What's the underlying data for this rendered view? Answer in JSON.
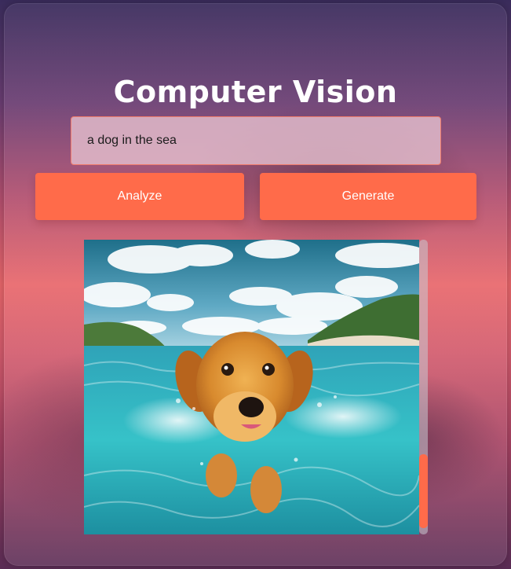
{
  "app": {
    "title": "Computer Vision"
  },
  "prompt": {
    "value": "a dog in the sea"
  },
  "actions": {
    "analyze_label": "Analyze",
    "generate_label": "Generate"
  },
  "image": {
    "icon": "generated-image"
  },
  "colors": {
    "accent": "#ff6b4a",
    "title_text": "#ffffff",
    "input_border": "#ef7a6a"
  },
  "scroll": {
    "position_fraction": 0.78
  }
}
